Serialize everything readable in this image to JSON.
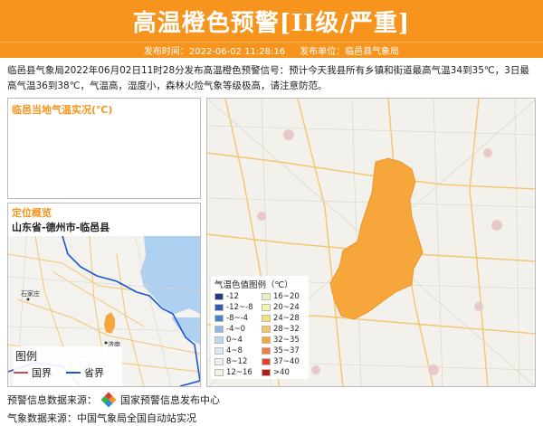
{
  "header": {
    "title": "高温橙色预警[II级/严重]"
  },
  "meta": {
    "publish_time": "发布时间：2022-06-02 11:28:16",
    "publisher": "发布单位：临邑县气象局"
  },
  "description": "临邑县气象局2022年06月02日11时28分发布高温橙色预警信号：预计今天我县所有乡镇和街道最高气温34到35℃，3日最高气温36到38℃，气温高，湿度小，森林火险气象等级极高，请注意防范。",
  "realtime_panel": {
    "title": "临邑当地气温实况(℃)"
  },
  "location_panel": {
    "title": "定位概览",
    "path": "山东省-德州市-临邑县"
  },
  "mini_map": {
    "labels": {
      "shijiazhuang": "石家庄",
      "jinan": "济南"
    },
    "legend_title": "图例",
    "legend_items": [
      {
        "label": "国界",
        "color": "#c94a5a"
      },
      {
        "label": "省界",
        "color": "#1a57d6"
      }
    ]
  },
  "main_map": {
    "legend_title": "气温色值图例（℃）",
    "legend_items": [
      {
        "label": "-12",
        "color": "#1f3c8a"
      },
      {
        "label": "16~20",
        "color": "#e8f3c4"
      },
      {
        "label": "-12~-8",
        "color": "#2f5bb3"
      },
      {
        "label": "20~24",
        "color": "#f3f3a6"
      },
      {
        "label": "-8~-4",
        "color": "#4f7fd0"
      },
      {
        "label": "24~28",
        "color": "#f7e27a"
      },
      {
        "label": "-4~0",
        "color": "#8fb4e6"
      },
      {
        "label": "28~32",
        "color": "#f6c65c"
      },
      {
        "label": "0~4",
        "color": "#bcd7f2"
      },
      {
        "label": "32~35",
        "color": "#f7a63c"
      },
      {
        "label": "4~8",
        "color": "#d7ebf6"
      },
      {
        "label": "35~37",
        "color": "#f27b3a"
      },
      {
        "label": "8~12",
        "color": "#e6f5ec"
      },
      {
        "label": "37~40",
        "color": "#e0452b"
      },
      {
        "label": "12~16",
        "color": "#eaf6e0"
      },
      {
        "label": ">40",
        "color": "#b51d14"
      }
    ],
    "region_color": "#f7a63c"
  },
  "footer": {
    "warning_source_label": "预警信息数据来源：",
    "warning_source": "国家预警信息发布中心",
    "weather_source": "气象数据来源：中国气象局全国自动站实况"
  }
}
